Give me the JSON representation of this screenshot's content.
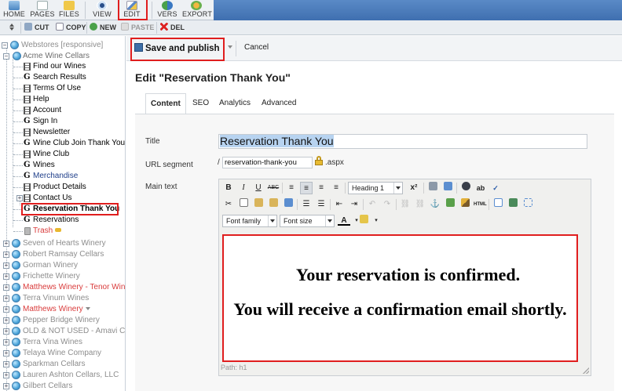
{
  "toolbar": {
    "buttons": [
      {
        "label": "HOME"
      },
      {
        "label": "PAGES"
      },
      {
        "label": "FILES"
      },
      {
        "label": "VIEW"
      },
      {
        "label": "EDIT"
      },
      {
        "label": "VERS"
      },
      {
        "label": "EXPORT"
      }
    ]
  },
  "toolbar2": {
    "cut": "CUT",
    "copy": "COPY",
    "new": "NEW",
    "paste": "PASTE",
    "del": "DEL"
  },
  "sidebar": {
    "root": "Webstores [responsive]",
    "items": [
      {
        "label": "Acme Wine Cellars"
      },
      {
        "label": "Find our Wines"
      },
      {
        "label": "Search Results"
      },
      {
        "label": "Terms Of Use"
      },
      {
        "label": "Help"
      },
      {
        "label": "Account"
      },
      {
        "label": "Sign In"
      },
      {
        "label": "Newsletter"
      },
      {
        "label": "Wine Club Join Thank You"
      },
      {
        "label": "Wine Club"
      },
      {
        "label": "Wines"
      },
      {
        "label": "Merchandise"
      },
      {
        "label": "Product Details"
      },
      {
        "label": "Contact Us"
      },
      {
        "label": "Reservation Thank You"
      },
      {
        "label": "Reservations"
      },
      {
        "label": "Trash"
      },
      {
        "label": "Seven of Hearts Winery"
      },
      {
        "label": "Robert Ramsay Cellars"
      },
      {
        "label": "Gorman Winery"
      },
      {
        "label": "Frichette Winery"
      },
      {
        "label": "Matthews Winery - Tenor Wines"
      },
      {
        "label": "Terra Vinum Wines"
      },
      {
        "label": "Matthews Winery"
      },
      {
        "label": "Pepper Bridge Winery"
      },
      {
        "label": "OLD & NOT USED - Amavi Cellars"
      },
      {
        "label": "Terra Vina Wines"
      },
      {
        "label": "Telaya Wine Company"
      },
      {
        "label": "Sparkman Cellars"
      },
      {
        "label": "Lauren Ashton Cellars, LLC"
      },
      {
        "label": "Gilbert Cellars"
      }
    ]
  },
  "main": {
    "save_label": "Save and publish",
    "cancel_label": "Cancel",
    "page_title": "Edit \"Reservation Thank You\"",
    "tabs": [
      {
        "label": "Content"
      },
      {
        "label": "SEO"
      },
      {
        "label": "Analytics"
      },
      {
        "label": "Advanced"
      }
    ],
    "form": {
      "title_label": "Title",
      "title_value": "Reservation Thank You",
      "segment_label": "URL segment",
      "segment_prefix": "/",
      "segment_value": "reservation-thank-you",
      "segment_suffix": ".aspx",
      "main_text_label": "Main text"
    },
    "editor": {
      "format_select": "Heading 1",
      "font_family_select": "Font family",
      "font_size_select": "Font size",
      "content_line1": "Your reservation is confirmed.",
      "content_line2": "You will receive a confirmation email shortly.",
      "path": "Path: h1"
    }
  },
  "colors": {
    "highlight_red": "#e01e1e",
    "toolbar_blue": "#4a7cbd",
    "grey_item": "#8d8d8d",
    "red_item": "#d93b3b"
  }
}
